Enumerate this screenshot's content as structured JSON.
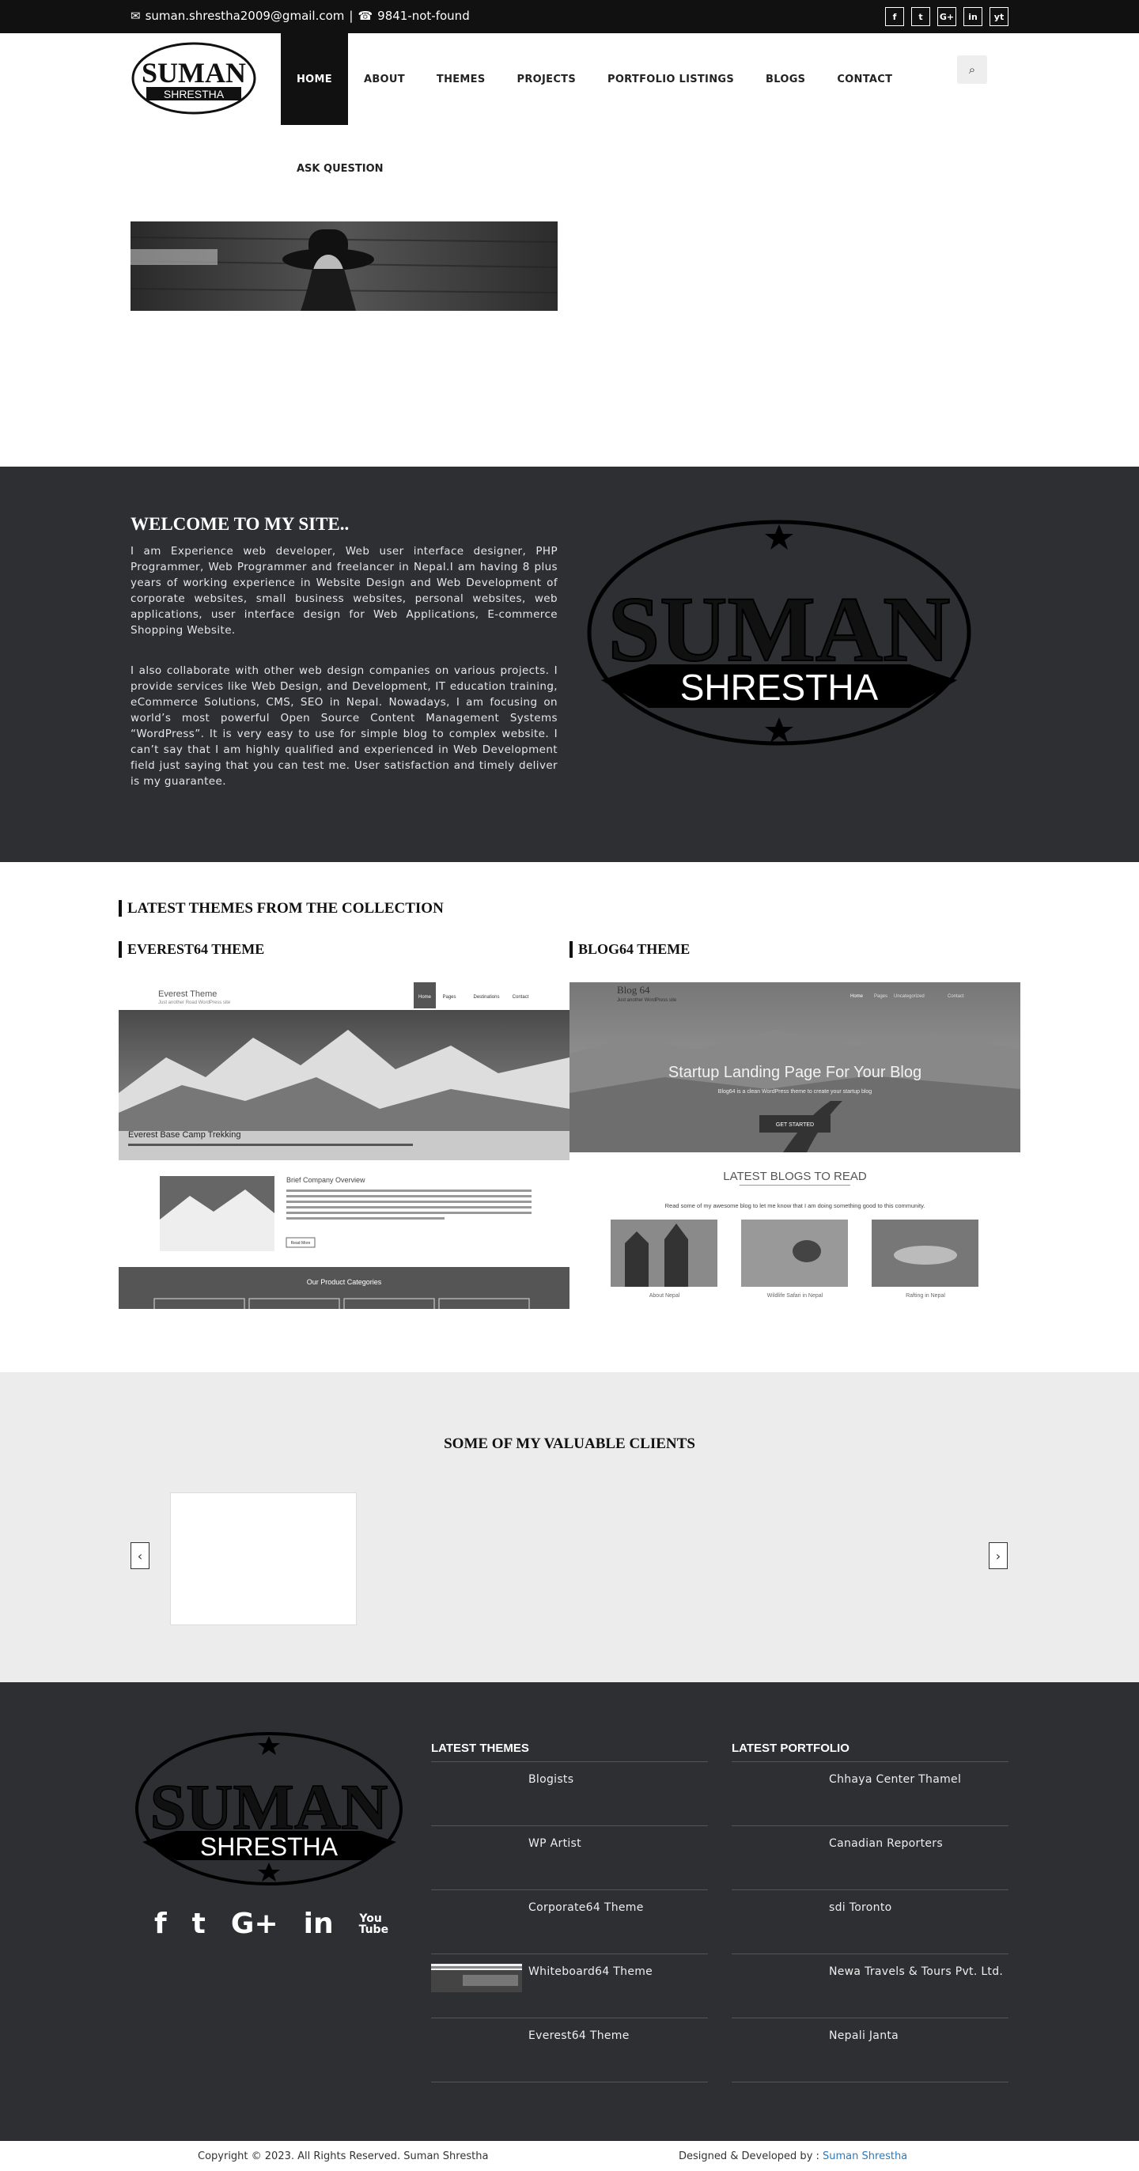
{
  "topbar": {
    "email": "suman.shrestha2009@gmail.com",
    "separator": "|",
    "phone": "9841-not-found",
    "social": [
      "f",
      "t",
      "G+",
      "in",
      "yt"
    ]
  },
  "logo": {
    "line1": "SUMAN",
    "line2": "SHRESTHA"
  },
  "nav": {
    "items": [
      "HOME",
      "ABOUT",
      "THEMES",
      "PROJECTS",
      "PORTFOLIO LISTINGS",
      "BLOGS",
      "CONTACT"
    ],
    "second_row": "ASK QUESTION",
    "active": "HOME"
  },
  "welcome": {
    "title": "WELCOME TO MY SITE..",
    "p1": "I am Experience web developer, Web user interface designer, PHP Programmer, Web Programmer and freelancer in Nepal.I am having 8 plus years of working experience in Website Design and Web Development of corporate websites, small business websites, personal websites, web applications, user interface design for Web Applications, E-commerce Shopping Website.",
    "p2": "I also collaborate with other web design companies on various projects. I provide services like Web Design, and Development, IT education training, eCommerce Solutions, CMS, SEO in Nepal. Nowadays, I am focusing on world’s most powerful Open Source Content Management Systems “WordPress”. It is very easy to use for simple blog to complex website. I can’t say that I am highly qualified and experienced in Web Development field just saying that you can test me. User satisfaction and timely deliver is my guarantee."
  },
  "themes": {
    "section_title": "LATEST THEMES FROM THE COLLECTION",
    "left_title": "EVEREST64 THEME",
    "right_title": "BLOG64 THEME",
    "everest": {
      "site_name": "Everest Theme",
      "tagline": "Just another Road WordPress site",
      "menu": [
        "Home",
        "Pages",
        "Destinations",
        "Contact"
      ],
      "hero_caption": "Everest Base Camp Trekking",
      "overview_title": "Brief Company Overview",
      "read_more": "Read More",
      "categories_title": "Our Product Categories"
    },
    "blog": {
      "site_name": "Blog 64",
      "tagline": "Just another WordPress site",
      "menu": [
        "Home",
        "Pages",
        "Uncategorized",
        "Contact"
      ],
      "hero_title": "Startup Landing Page For Your Blog",
      "hero_sub": "Blog64 is a clean WordPress theme to create your startup blog",
      "cta": "GET STARTED",
      "latest_title": "LATEST BLOGS TO READ",
      "latest_sub": "Read some of my awesome blog to let me know that I am doing something good to this community.",
      "posts": [
        "About Nepal",
        "Wildlife Safari in Nepal",
        "Rafting in Nepal"
      ]
    }
  },
  "clients": {
    "title": "SOME OF MY VALUABLE CLIENTS",
    "prev": "‹",
    "next": "›"
  },
  "footer": {
    "latest_themes_title": "LATEST THEMES",
    "latest_themes": [
      "Blogists",
      "WP Artist",
      "Corporate64 Theme",
      "Whiteboard64 Theme",
      "Everest64 Theme"
    ],
    "latest_portfolio_title": "LATEST PORTFOLIO",
    "latest_portfolio": [
      "Chhaya Center Thamel",
      "Canadian Reporters",
      "sdi Toronto",
      "Newa Travels & Tours Pvt. Ltd.",
      "Nepali Janta"
    ],
    "social_icons": [
      "f",
      "t",
      "G+",
      "in",
      "You Tube"
    ]
  },
  "copyright": {
    "left": "Copyright © 2023. All Rights Reserved. Suman Shrestha",
    "right_prefix": "Designed & Developed by : ",
    "right_link": "Suman Shrestha"
  },
  "colors": {
    "topbar": "#111111",
    "dark_section": "#2e2f33",
    "clients_bg": "#ececec",
    "link": "#2b7bbf"
  }
}
